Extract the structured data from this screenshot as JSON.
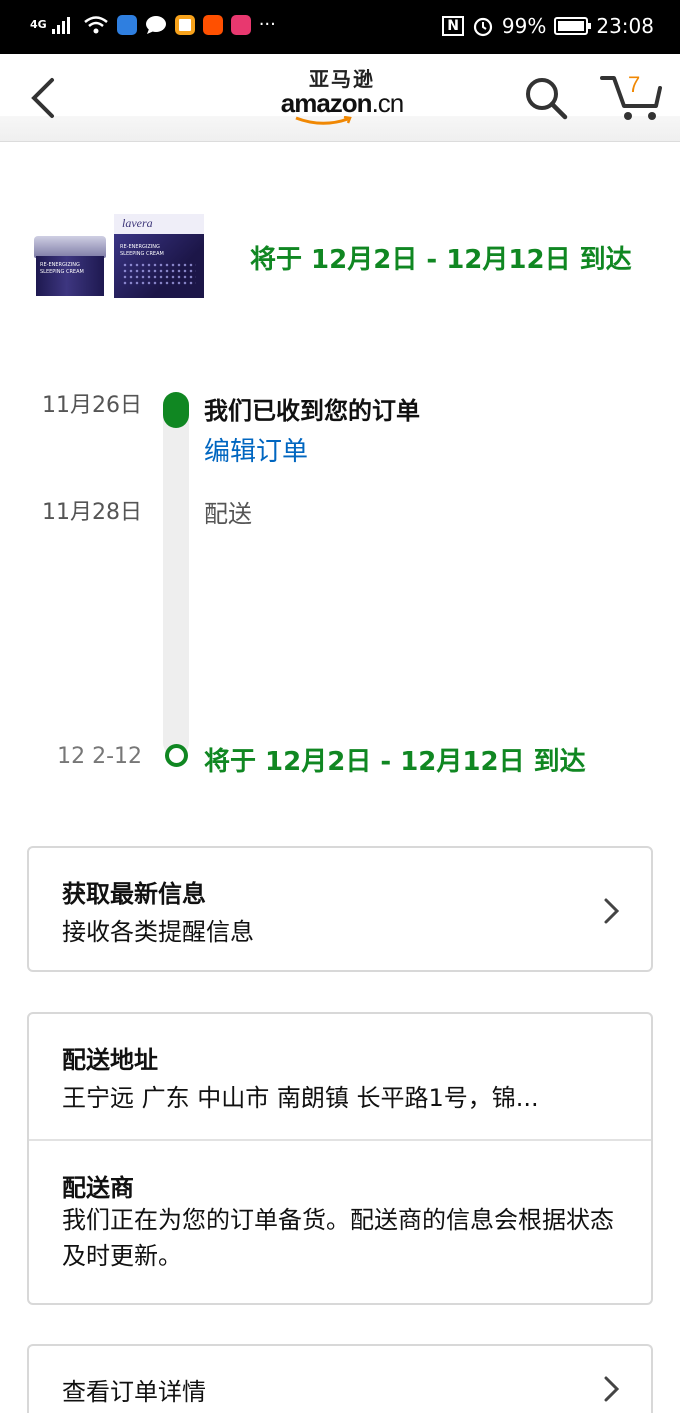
{
  "status_bar": {
    "network": "4G",
    "nfc": "N",
    "battery": "99%",
    "time": "23:08",
    "more": "···"
  },
  "header": {
    "logo_cn": "亚马逊",
    "logo_en": "amazon",
    "logo_suffix": ".cn",
    "cart_count": "7"
  },
  "summary": {
    "arrival": "将于 12月2日 - 12月12日 到达",
    "product_brand": "lavera",
    "product_name": "RE-ENERGIZING SLEEPING CREAM"
  },
  "timeline": [
    {
      "date": "11月26日",
      "event": "我们已收到您的订单",
      "link": "编辑订单"
    },
    {
      "date": "11月28日",
      "event": "配送"
    },
    {
      "date": "12 2-12",
      "event": "将于 12月2日 - 12月12日 到达"
    }
  ],
  "updates_card": {
    "title": "获取最新信息",
    "subtitle": "接收各类提醒信息"
  },
  "delivery_card": {
    "address_title": "配送地址",
    "address_text": "王宁远 广东 中山市 南朗镇 长平路1号，锦...",
    "carrier_title": "配送商",
    "carrier_text": "我们正在为您的订单备货。配送商的信息会根据状态及时更新。"
  },
  "details_card": {
    "label": "查看订单详情"
  },
  "colors": {
    "green": "#108722",
    "link_blue": "#0066c0",
    "cart_orange": "#f08804"
  }
}
